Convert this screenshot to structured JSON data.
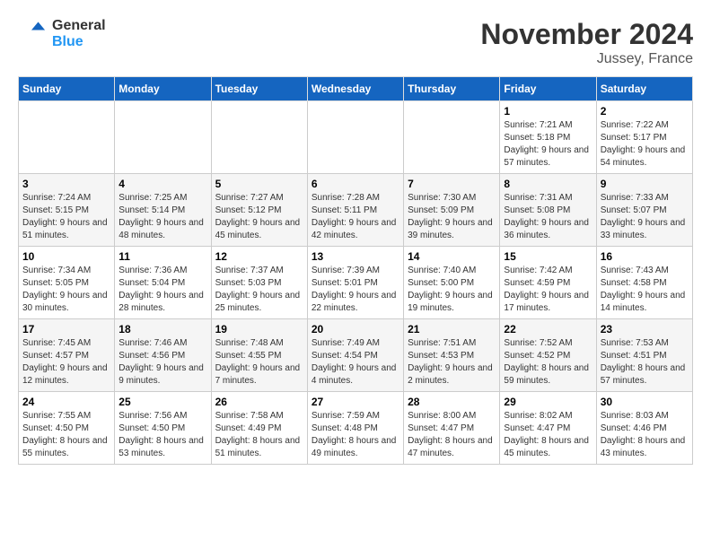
{
  "header": {
    "logo_line1": "General",
    "logo_line2": "Blue",
    "month_title": "November 2024",
    "subtitle": "Jussey, France"
  },
  "weekdays": [
    "Sunday",
    "Monday",
    "Tuesday",
    "Wednesday",
    "Thursday",
    "Friday",
    "Saturday"
  ],
  "weeks": [
    [
      {
        "day": "",
        "info": ""
      },
      {
        "day": "",
        "info": ""
      },
      {
        "day": "",
        "info": ""
      },
      {
        "day": "",
        "info": ""
      },
      {
        "day": "",
        "info": ""
      },
      {
        "day": "1",
        "info": "Sunrise: 7:21 AM\nSunset: 5:18 PM\nDaylight: 9 hours and 57 minutes."
      },
      {
        "day": "2",
        "info": "Sunrise: 7:22 AM\nSunset: 5:17 PM\nDaylight: 9 hours and 54 minutes."
      }
    ],
    [
      {
        "day": "3",
        "info": "Sunrise: 7:24 AM\nSunset: 5:15 PM\nDaylight: 9 hours and 51 minutes."
      },
      {
        "day": "4",
        "info": "Sunrise: 7:25 AM\nSunset: 5:14 PM\nDaylight: 9 hours and 48 minutes."
      },
      {
        "day": "5",
        "info": "Sunrise: 7:27 AM\nSunset: 5:12 PM\nDaylight: 9 hours and 45 minutes."
      },
      {
        "day": "6",
        "info": "Sunrise: 7:28 AM\nSunset: 5:11 PM\nDaylight: 9 hours and 42 minutes."
      },
      {
        "day": "7",
        "info": "Sunrise: 7:30 AM\nSunset: 5:09 PM\nDaylight: 9 hours and 39 minutes."
      },
      {
        "day": "8",
        "info": "Sunrise: 7:31 AM\nSunset: 5:08 PM\nDaylight: 9 hours and 36 minutes."
      },
      {
        "day": "9",
        "info": "Sunrise: 7:33 AM\nSunset: 5:07 PM\nDaylight: 9 hours and 33 minutes."
      }
    ],
    [
      {
        "day": "10",
        "info": "Sunrise: 7:34 AM\nSunset: 5:05 PM\nDaylight: 9 hours and 30 minutes."
      },
      {
        "day": "11",
        "info": "Sunrise: 7:36 AM\nSunset: 5:04 PM\nDaylight: 9 hours and 28 minutes."
      },
      {
        "day": "12",
        "info": "Sunrise: 7:37 AM\nSunset: 5:03 PM\nDaylight: 9 hours and 25 minutes."
      },
      {
        "day": "13",
        "info": "Sunrise: 7:39 AM\nSunset: 5:01 PM\nDaylight: 9 hours and 22 minutes."
      },
      {
        "day": "14",
        "info": "Sunrise: 7:40 AM\nSunset: 5:00 PM\nDaylight: 9 hours and 19 minutes."
      },
      {
        "day": "15",
        "info": "Sunrise: 7:42 AM\nSunset: 4:59 PM\nDaylight: 9 hours and 17 minutes."
      },
      {
        "day": "16",
        "info": "Sunrise: 7:43 AM\nSunset: 4:58 PM\nDaylight: 9 hours and 14 minutes."
      }
    ],
    [
      {
        "day": "17",
        "info": "Sunrise: 7:45 AM\nSunset: 4:57 PM\nDaylight: 9 hours and 12 minutes."
      },
      {
        "day": "18",
        "info": "Sunrise: 7:46 AM\nSunset: 4:56 PM\nDaylight: 9 hours and 9 minutes."
      },
      {
        "day": "19",
        "info": "Sunrise: 7:48 AM\nSunset: 4:55 PM\nDaylight: 9 hours and 7 minutes."
      },
      {
        "day": "20",
        "info": "Sunrise: 7:49 AM\nSunset: 4:54 PM\nDaylight: 9 hours and 4 minutes."
      },
      {
        "day": "21",
        "info": "Sunrise: 7:51 AM\nSunset: 4:53 PM\nDaylight: 9 hours and 2 minutes."
      },
      {
        "day": "22",
        "info": "Sunrise: 7:52 AM\nSunset: 4:52 PM\nDaylight: 8 hours and 59 minutes."
      },
      {
        "day": "23",
        "info": "Sunrise: 7:53 AM\nSunset: 4:51 PM\nDaylight: 8 hours and 57 minutes."
      }
    ],
    [
      {
        "day": "24",
        "info": "Sunrise: 7:55 AM\nSunset: 4:50 PM\nDaylight: 8 hours and 55 minutes."
      },
      {
        "day": "25",
        "info": "Sunrise: 7:56 AM\nSunset: 4:50 PM\nDaylight: 8 hours and 53 minutes."
      },
      {
        "day": "26",
        "info": "Sunrise: 7:58 AM\nSunset: 4:49 PM\nDaylight: 8 hours and 51 minutes."
      },
      {
        "day": "27",
        "info": "Sunrise: 7:59 AM\nSunset: 4:48 PM\nDaylight: 8 hours and 49 minutes."
      },
      {
        "day": "28",
        "info": "Sunrise: 8:00 AM\nSunset: 4:47 PM\nDaylight: 8 hours and 47 minutes."
      },
      {
        "day": "29",
        "info": "Sunrise: 8:02 AM\nSunset: 4:47 PM\nDaylight: 8 hours and 45 minutes."
      },
      {
        "day": "30",
        "info": "Sunrise: 8:03 AM\nSunset: 4:46 PM\nDaylight: 8 hours and 43 minutes."
      }
    ]
  ]
}
